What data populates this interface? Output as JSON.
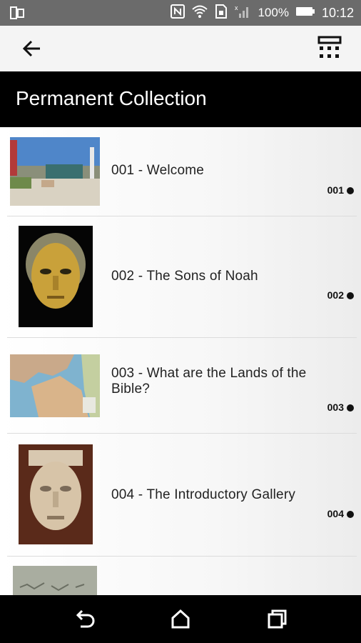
{
  "status_bar": {
    "battery": "100%",
    "time": "10:12",
    "icons": [
      "screen-mirror-icon",
      "nfc-icon",
      "wifi-icon",
      "sd-card-icon",
      "signal-icon",
      "battery-icon"
    ]
  },
  "app_bar": {
    "back_icon": "back-arrow-icon",
    "keypad_icon": "keypad-icon"
  },
  "header": {
    "title": "Permanent Collection"
  },
  "stops": [
    {
      "title": "001 - Welcome",
      "code": "001",
      "image": "museum-exterior"
    },
    {
      "title": "002 - The Sons of Noah",
      "code": "002",
      "image": "gold-mask"
    },
    {
      "title": "003 - What are the Lands of the Bible?",
      "code": "003",
      "image": "map"
    },
    {
      "title": "004 - The Introductory Gallery",
      "code": "004",
      "image": "stone-head"
    },
    {
      "title": "",
      "code": "",
      "image": "inscription"
    }
  ],
  "nav_bar": {
    "icons": [
      "back-nav-icon",
      "home-nav-icon",
      "recents-nav-icon"
    ]
  },
  "colors": {
    "status_bg": "#6b6b6b",
    "appbar_bg": "#f4f4f4",
    "title_bg": "#000000",
    "navbar_bg": "#000000"
  }
}
